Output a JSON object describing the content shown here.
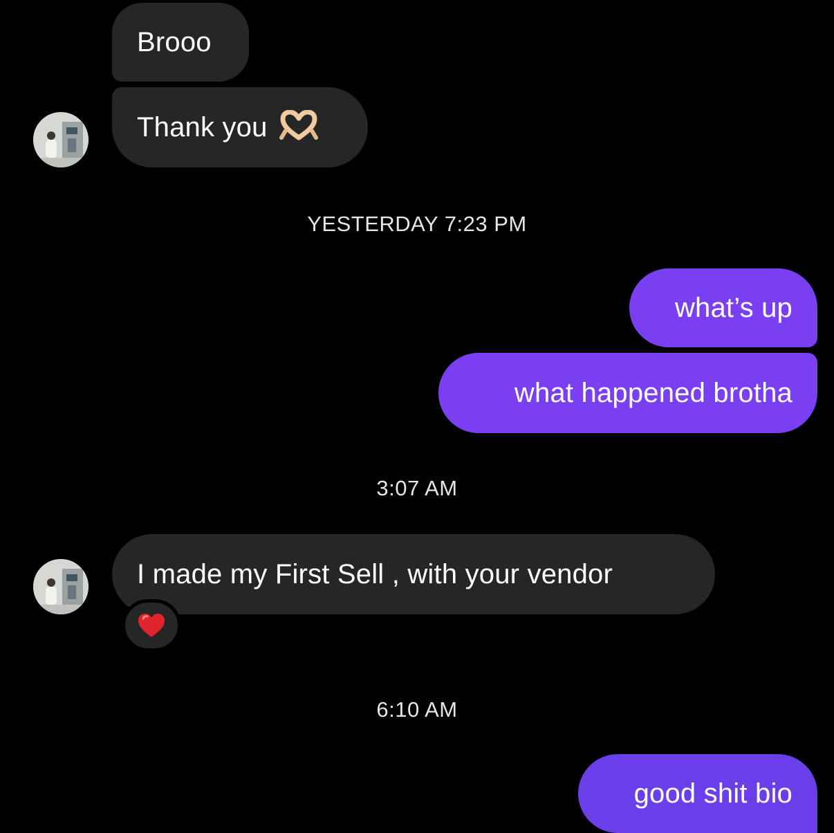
{
  "colors": {
    "background": "#000000",
    "incoming_bubble": "#262626",
    "outgoing_bubble": "#7a3ff0",
    "text": "#ffffff",
    "heart": "#e0242c"
  },
  "messages": [
    {
      "direction": "incoming",
      "text": "Brooo"
    },
    {
      "direction": "incoming",
      "text": "Thank you",
      "emoji": "heart-hands-icon"
    },
    {
      "direction": "outgoing",
      "text": "what’s up"
    },
    {
      "direction": "outgoing",
      "text": "what happened brotha"
    },
    {
      "direction": "incoming",
      "text": "I made my First Sell , with your vendor",
      "reaction": "red-heart-icon"
    },
    {
      "direction": "outgoing",
      "text": "good shit bio"
    }
  ],
  "timestamps": {
    "first": "YESTERDAY 7:23 PM",
    "second": "3:07 AM",
    "third": "6:10 AM"
  }
}
